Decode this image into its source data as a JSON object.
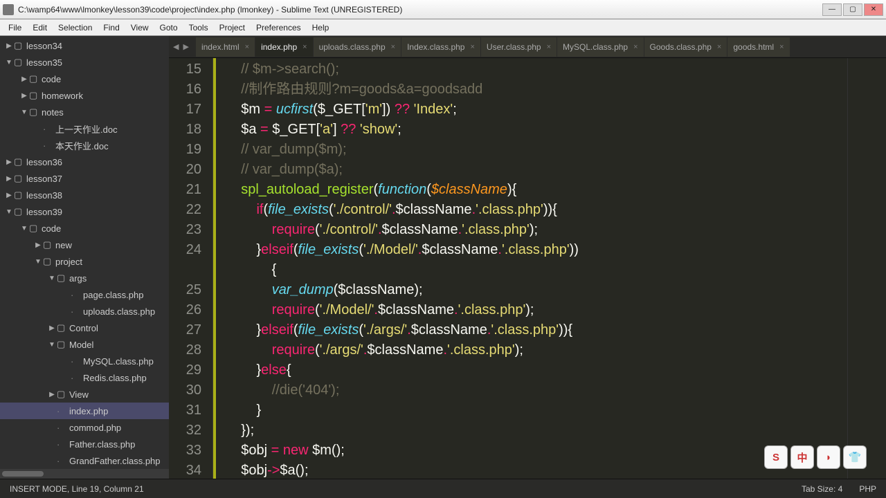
{
  "window": {
    "title": "C:\\wamp64\\www\\lmonkey\\lesson39\\code\\project\\index.php (lmonkey) - Sublime Text (UNREGISTERED)"
  },
  "menu": [
    "File",
    "Edit",
    "Selection",
    "Find",
    "View",
    "Goto",
    "Tools",
    "Project",
    "Preferences",
    "Help"
  ],
  "sidebar": {
    "items": [
      {
        "label": "lesson34",
        "indent": 0,
        "arrow": "▶",
        "type": "folder"
      },
      {
        "label": "lesson35",
        "indent": 0,
        "arrow": "▼",
        "type": "folder"
      },
      {
        "label": "code",
        "indent": 1,
        "arrow": "▶",
        "type": "folder"
      },
      {
        "label": "homework",
        "indent": 1,
        "arrow": "▶",
        "type": "folder"
      },
      {
        "label": "notes",
        "indent": 1,
        "arrow": "▼",
        "type": "folder"
      },
      {
        "label": "上一天作业.doc",
        "indent": 2,
        "arrow": "",
        "type": "file"
      },
      {
        "label": "本天作业.doc",
        "indent": 2,
        "arrow": "",
        "type": "file"
      },
      {
        "label": "lesson36",
        "indent": 0,
        "arrow": "▶",
        "type": "folder"
      },
      {
        "label": "lesson37",
        "indent": 0,
        "arrow": "▶",
        "type": "folder"
      },
      {
        "label": "lesson38",
        "indent": 0,
        "arrow": "▶",
        "type": "folder"
      },
      {
        "label": "lesson39",
        "indent": 0,
        "arrow": "▼",
        "type": "folder"
      },
      {
        "label": "code",
        "indent": 1,
        "arrow": "▼",
        "type": "folder"
      },
      {
        "label": "new",
        "indent": 2,
        "arrow": "▶",
        "type": "folder"
      },
      {
        "label": "project",
        "indent": 2,
        "arrow": "▼",
        "type": "folder"
      },
      {
        "label": "args",
        "indent": 3,
        "arrow": "▼",
        "type": "folder"
      },
      {
        "label": "page.class.php",
        "indent": 4,
        "arrow": "",
        "type": "file"
      },
      {
        "label": "uploads.class.php",
        "indent": 4,
        "arrow": "",
        "type": "file"
      },
      {
        "label": "Control",
        "indent": 3,
        "arrow": "▶",
        "type": "folder"
      },
      {
        "label": "Model",
        "indent": 3,
        "arrow": "▼",
        "type": "folder"
      },
      {
        "label": "MySQL.class.php",
        "indent": 4,
        "arrow": "",
        "type": "file"
      },
      {
        "label": "Redis.class.php",
        "indent": 4,
        "arrow": "",
        "type": "file"
      },
      {
        "label": "View",
        "indent": 3,
        "arrow": "▶",
        "type": "folder"
      },
      {
        "label": "index.php",
        "indent": 3,
        "arrow": "",
        "type": "file",
        "selected": true
      },
      {
        "label": "commod.php",
        "indent": 3,
        "arrow": "",
        "type": "file"
      },
      {
        "label": "Father.class.php",
        "indent": 3,
        "arrow": "",
        "type": "file"
      },
      {
        "label": "GrandFather.class.php",
        "indent": 3,
        "arrow": "",
        "type": "file"
      }
    ]
  },
  "tabs": [
    {
      "label": "index.html",
      "active": false
    },
    {
      "label": "index.php",
      "active": true
    },
    {
      "label": "uploads.class.php",
      "active": false
    },
    {
      "label": "Index.class.php",
      "active": false
    },
    {
      "label": "User.class.php",
      "active": false
    },
    {
      "label": "MySQL.class.php",
      "active": false
    },
    {
      "label": "Goods.class.php",
      "active": false
    },
    {
      "label": "goods.html",
      "active": false
    }
  ],
  "line_numbers": [
    "15",
    "16",
    "17",
    "18",
    "19",
    "20",
    "21",
    "22",
    "23",
    "24",
    "",
    "25",
    "26",
    "27",
    "28",
    "29",
    "30",
    "31",
    "32",
    "33",
    "34"
  ],
  "code_lines": [
    {
      "spans": [
        {
          "t": "    ",
          "c": "c-plain"
        },
        {
          "t": "// $m->search();",
          "c": "c-comment"
        }
      ]
    },
    {
      "spans": [
        {
          "t": "    ",
          "c": "c-plain"
        },
        {
          "t": "//制作路由规则?m=goods&a=goodsadd",
          "c": "c-comment"
        }
      ]
    },
    {
      "spans": [
        {
          "t": "    $m ",
          "c": "c-plain"
        },
        {
          "t": "=",
          "c": "c-keyword"
        },
        {
          "t": " ",
          "c": "c-plain"
        },
        {
          "t": "ucfirst",
          "c": "c-func"
        },
        {
          "t": "($_GET[",
          "c": "c-plain"
        },
        {
          "t": "'m'",
          "c": "c-string"
        },
        {
          "t": "]) ",
          "c": "c-plain"
        },
        {
          "t": "??",
          "c": "c-keyword"
        },
        {
          "t": " ",
          "c": "c-plain"
        },
        {
          "t": "'Index'",
          "c": "c-string"
        },
        {
          "t": ";",
          "c": "c-plain"
        }
      ]
    },
    {
      "spans": [
        {
          "t": "    $a ",
          "c": "c-plain"
        },
        {
          "t": "=",
          "c": "c-keyword"
        },
        {
          "t": " $_GET[",
          "c": "c-plain"
        },
        {
          "t": "'a'",
          "c": "c-string"
        },
        {
          "t": "] ",
          "c": "c-plain"
        },
        {
          "t": "??",
          "c": "c-keyword"
        },
        {
          "t": " ",
          "c": "c-plain"
        },
        {
          "t": "'show'",
          "c": "c-string"
        },
        {
          "t": ";",
          "c": "c-plain"
        }
      ]
    },
    {
      "spans": [
        {
          "t": "    ",
          "c": "c-plain"
        },
        {
          "t": "// var_dump($m);",
          "c": "c-comment"
        }
      ]
    },
    {
      "spans": [
        {
          "t": "    ",
          "c": "c-plain"
        },
        {
          "t": "// var_dump($a);",
          "c": "c-comment"
        }
      ]
    },
    {
      "spans": [
        {
          "t": "    ",
          "c": "c-plain"
        },
        {
          "t": "spl_autoload_register",
          "c": "c-name"
        },
        {
          "t": "(",
          "c": "c-plain"
        },
        {
          "t": "function",
          "c": "c-func"
        },
        {
          "t": "(",
          "c": "c-plain"
        },
        {
          "t": "$className",
          "c": "c-var"
        },
        {
          "t": "){",
          "c": "c-plain"
        }
      ]
    },
    {
      "spans": [
        {
          "t": "        ",
          "c": "c-plain"
        },
        {
          "t": "if",
          "c": "c-keyword"
        },
        {
          "t": "(",
          "c": "c-plain"
        },
        {
          "t": "file_exists",
          "c": "c-func"
        },
        {
          "t": "(",
          "c": "c-plain"
        },
        {
          "t": "'./control/'",
          "c": "c-string"
        },
        {
          "t": ".",
          "c": "c-keyword"
        },
        {
          "t": "$className",
          "c": "c-plain"
        },
        {
          "t": ".",
          "c": "c-keyword"
        },
        {
          "t": "'.class.php'",
          "c": "c-string"
        },
        {
          "t": ")){",
          "c": "c-plain"
        }
      ]
    },
    {
      "spans": [
        {
          "t": "            ",
          "c": "c-plain"
        },
        {
          "t": "require",
          "c": "c-keyword"
        },
        {
          "t": "(",
          "c": "c-plain"
        },
        {
          "t": "'./control/'",
          "c": "c-string"
        },
        {
          "t": ".",
          "c": "c-keyword"
        },
        {
          "t": "$className",
          "c": "c-plain"
        },
        {
          "t": ".",
          "c": "c-keyword"
        },
        {
          "t": "'.class.php'",
          "c": "c-string"
        },
        {
          "t": ");",
          "c": "c-plain"
        }
      ]
    },
    {
      "spans": [
        {
          "t": "        }",
          "c": "c-plain"
        },
        {
          "t": "elseif",
          "c": "c-keyword"
        },
        {
          "t": "(",
          "c": "c-plain"
        },
        {
          "t": "file_exists",
          "c": "c-func"
        },
        {
          "t": "(",
          "c": "c-plain"
        },
        {
          "t": "'./Model/'",
          "c": "c-string"
        },
        {
          "t": ".",
          "c": "c-keyword"
        },
        {
          "t": "$className",
          "c": "c-plain"
        },
        {
          "t": ".",
          "c": "c-keyword"
        },
        {
          "t": "'.class.php'",
          "c": "c-string"
        },
        {
          "t": "))",
          "c": "c-plain"
        }
      ]
    },
    {
      "spans": [
        {
          "t": "            {",
          "c": "c-plain"
        }
      ]
    },
    {
      "spans": [
        {
          "t": "            ",
          "c": "c-plain"
        },
        {
          "t": "var_dump",
          "c": "c-func"
        },
        {
          "t": "($className);",
          "c": "c-plain"
        }
      ]
    },
    {
      "spans": [
        {
          "t": "            ",
          "c": "c-plain"
        },
        {
          "t": "require",
          "c": "c-keyword"
        },
        {
          "t": "(",
          "c": "c-plain"
        },
        {
          "t": "'./Model/'",
          "c": "c-string"
        },
        {
          "t": ".",
          "c": "c-keyword"
        },
        {
          "t": "$className",
          "c": "c-plain"
        },
        {
          "t": ".",
          "c": "c-keyword"
        },
        {
          "t": "'.class.php'",
          "c": "c-string"
        },
        {
          "t": ");",
          "c": "c-plain"
        }
      ]
    },
    {
      "spans": [
        {
          "t": "        }",
          "c": "c-plain"
        },
        {
          "t": "elseif",
          "c": "c-keyword"
        },
        {
          "t": "(",
          "c": "c-plain"
        },
        {
          "t": "file_exists",
          "c": "c-func"
        },
        {
          "t": "(",
          "c": "c-plain"
        },
        {
          "t": "'./args/'",
          "c": "c-string"
        },
        {
          "t": ".",
          "c": "c-keyword"
        },
        {
          "t": "$className",
          "c": "c-plain"
        },
        {
          "t": ".",
          "c": "c-keyword"
        },
        {
          "t": "'.class.php'",
          "c": "c-string"
        },
        {
          "t": ")){",
          "c": "c-plain"
        }
      ]
    },
    {
      "spans": [
        {
          "t": "            ",
          "c": "c-plain"
        },
        {
          "t": "require",
          "c": "c-keyword"
        },
        {
          "t": "(",
          "c": "c-plain"
        },
        {
          "t": "'./args/'",
          "c": "c-string"
        },
        {
          "t": ".",
          "c": "c-keyword"
        },
        {
          "t": "$className",
          "c": "c-plain"
        },
        {
          "t": ".",
          "c": "c-keyword"
        },
        {
          "t": "'.class.php'",
          "c": "c-string"
        },
        {
          "t": ");",
          "c": "c-plain"
        }
      ]
    },
    {
      "spans": [
        {
          "t": "        }",
          "c": "c-plain"
        },
        {
          "t": "else",
          "c": "c-keyword"
        },
        {
          "t": "{",
          "c": "c-plain"
        }
      ]
    },
    {
      "spans": [
        {
          "t": "            ",
          "c": "c-plain"
        },
        {
          "t": "//die('404');",
          "c": "c-comment"
        }
      ]
    },
    {
      "spans": [
        {
          "t": "        }",
          "c": "c-plain"
        }
      ]
    },
    {
      "spans": [
        {
          "t": "    });",
          "c": "c-plain"
        }
      ]
    },
    {
      "spans": [
        {
          "t": "    $obj ",
          "c": "c-plain"
        },
        {
          "t": "=",
          "c": "c-keyword"
        },
        {
          "t": " ",
          "c": "c-plain"
        },
        {
          "t": "new",
          "c": "c-keyword"
        },
        {
          "t": " $m();",
          "c": "c-plain"
        }
      ]
    },
    {
      "spans": [
        {
          "t": "    $obj",
          "c": "c-plain"
        },
        {
          "t": "->",
          "c": "c-keyword"
        },
        {
          "t": "$a();",
          "c": "c-plain"
        }
      ]
    }
  ],
  "status": {
    "left": "INSERT MODE, Line 19, Column 21",
    "tab_size": "Tab Size: 4",
    "syntax": "PHP"
  },
  "floater": [
    "S",
    "中",
    "◗",
    "👕"
  ]
}
